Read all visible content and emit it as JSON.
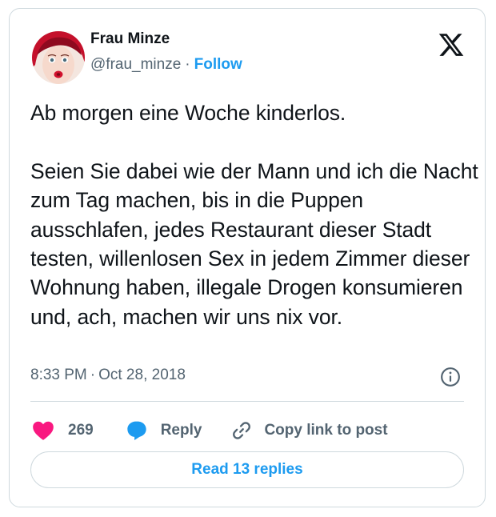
{
  "author": {
    "name": "Frau Minze",
    "handle": "@frau_minze",
    "separator": "·",
    "follow_label": "Follow",
    "avatar": "profile-photo-red-hair-avatar"
  },
  "brand": {
    "logo": "x-logo-icon"
  },
  "tweet": {
    "text": "Ab morgen eine Woche kinderlos.\n\nSeien Sie dabei wie der Mann und ich die Nacht zum Tag machen, bis in die Puppen ausschlafen, jedes Restaurant dieser Stadt testen, willenlosen Sex in jedem Zimmer dieser Wohnung haben, illegale Drogen konsumieren und, ach, machen wir uns nix vor.",
    "time": "8:33 PM",
    "separator": "·",
    "date": "Oct 28, 2018",
    "info_icon": "info-icon"
  },
  "actions": {
    "like": {
      "icon": "heart-icon",
      "count": "269"
    },
    "reply": {
      "icon": "speech-bubble-icon",
      "label": "Reply"
    },
    "copy": {
      "icon": "link-icon",
      "label": "Copy link to post"
    }
  },
  "read_replies_label": "Read 13 replies",
  "colors": {
    "accent": "#1d9bf0",
    "like": "#f91880",
    "text": "#0f1419",
    "secondary_text": "#536471",
    "border": "#cfd9de"
  }
}
